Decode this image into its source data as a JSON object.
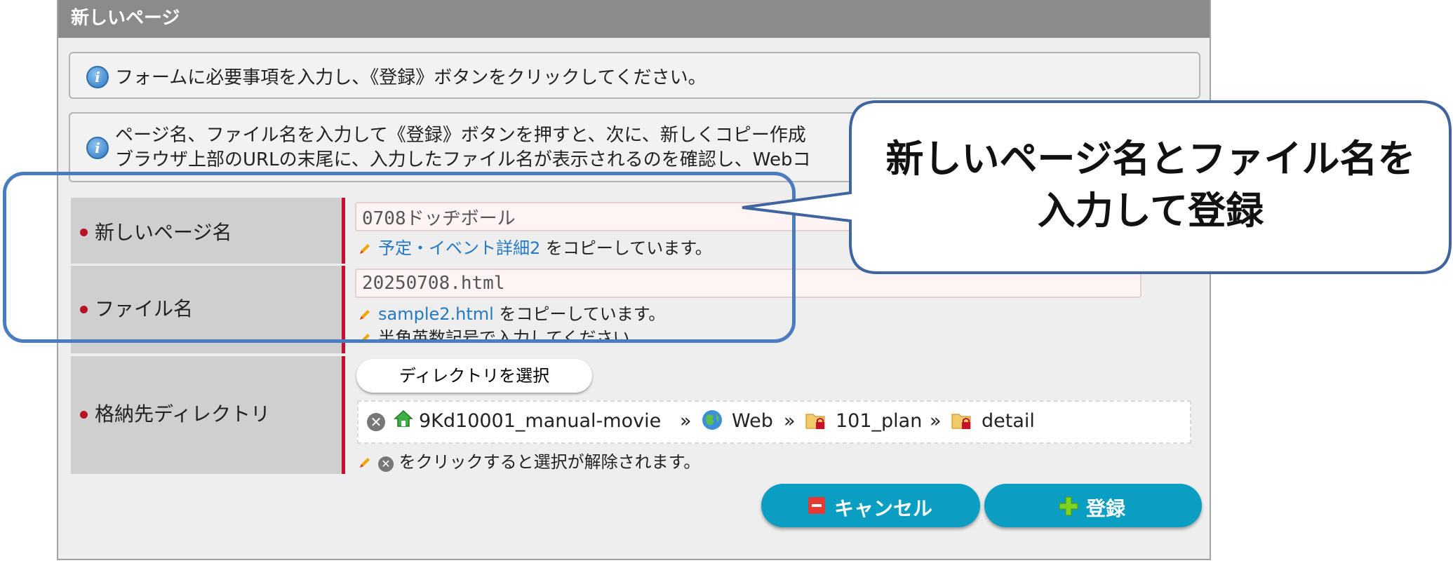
{
  "panel": {
    "title": "新しいページ"
  },
  "info": {
    "message1": "フォームに必要事項を入力し、《登録》ボタンをクリックしてください。",
    "message2_line1": "ページ名、ファイル名を入力して《登録》ボタンを押すと、次に、新しくコピー作成",
    "message2_line2": "ブラウザ上部のURLの末尾に、入力したファイル名が表示されるのを確認し、Webコ"
  },
  "form": {
    "page_name": {
      "label": "新しいページ名",
      "value": "0708ドッヂボール",
      "copy_source": "予定・イベント詳細2",
      "copy_suffix": "をコピーしています。"
    },
    "file_name": {
      "label": "ファイル名",
      "value": "20250708.html",
      "copy_source": "sample2.html",
      "copy_suffix": "をコピーしています。",
      "note": "半角英数記号で入力してください。"
    },
    "directory": {
      "label": "格納先ディレクトリ",
      "select_button": "ディレクトリを選択",
      "path": [
        "9Kd10001_manual-movie",
        "Web",
        "101_plan",
        "detail"
      ],
      "separator": "»",
      "hint": "をクリックすると選択が解除されます。"
    }
  },
  "buttons": {
    "cancel": "キャンセル",
    "submit": "登録"
  },
  "callout": {
    "line1": "新しいページ名とファイル名を",
    "line2": "入力して登録"
  },
  "colors": {
    "accent": "#0a9ec2",
    "required_bar": "#c8102e",
    "link": "#2379c3",
    "callout_border": "#3f649f"
  }
}
